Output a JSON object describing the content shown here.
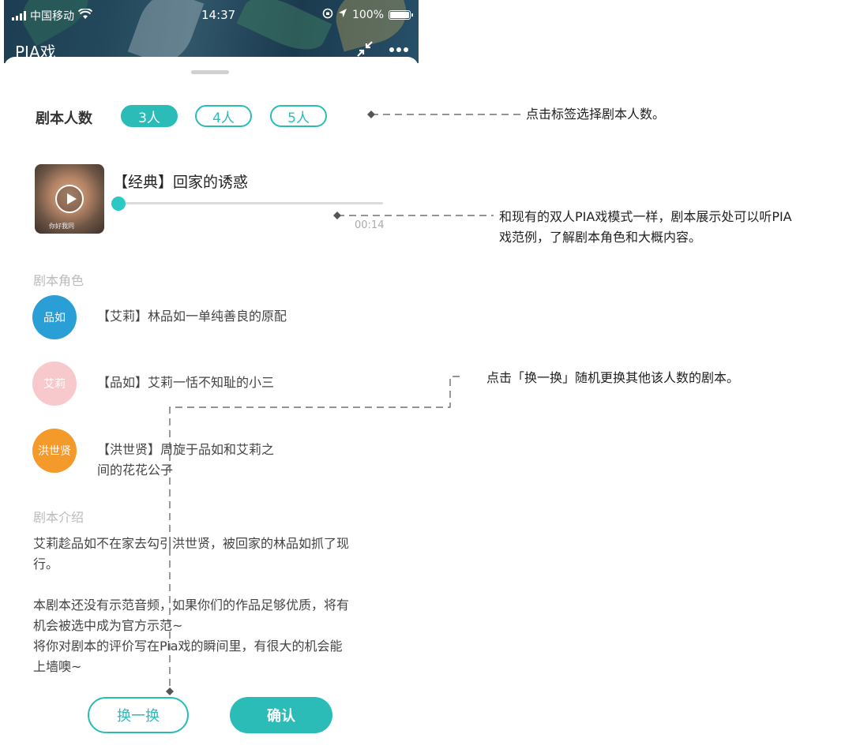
{
  "status_bar": {
    "carrier": "中国移动",
    "time": "14:37",
    "battery": "100%"
  },
  "header": {
    "title": "PIA戏"
  },
  "count_selector": {
    "label": "剧本人数",
    "options": [
      "3人",
      "4人",
      "5人"
    ],
    "selected": "3人"
  },
  "script": {
    "title": "【经典】回家的诱惑",
    "thumbnail_caption": "你好我同",
    "duration": "00:14"
  },
  "roles": {
    "heading": "剧本角色",
    "items": [
      {
        "avatar": "品如",
        "color": "#2a9fd6",
        "desc": "【艾莉】林品如一单纯善良的原配"
      },
      {
        "avatar": "艾莉",
        "color": "#f7c9cc",
        "desc": "【品如】艾莉一恬不知耻的小三"
      },
      {
        "avatar": "洪世贤",
        "color": "#f39a2b",
        "desc_line1": "【洪世贤】周旋于品如和艾莉之",
        "desc_line2": "间的花花公子"
      }
    ]
  },
  "intro": {
    "heading": "剧本介绍",
    "lines": [
      "艾莉趁品如不在家去勾引洪世贤，被回家的林品如抓了现",
      "行。",
      "",
      "本剧本还没有示范音频，如果你们的作品足够优质，将有",
      "机会被选中成为官方示范~",
      "将你对剧本的评价写在Pia戏的瞬间里，有很大的机会能",
      "上墙噢~"
    ]
  },
  "actions": {
    "change_label": "换一换",
    "confirm_label": "确认"
  },
  "annotations": {
    "count_note": "点击标签选择剧本人数。",
    "script_note_line1": "和现有的双人PIA戏模式一样，剧本展示处可以听PIA",
    "script_note_line2": "戏范例，了解剧本角色和大概内容。",
    "change_note": "点击「换一换」随机更换其他该人数的剧本。"
  },
  "colors": {
    "accent": "#2bbcb8"
  }
}
